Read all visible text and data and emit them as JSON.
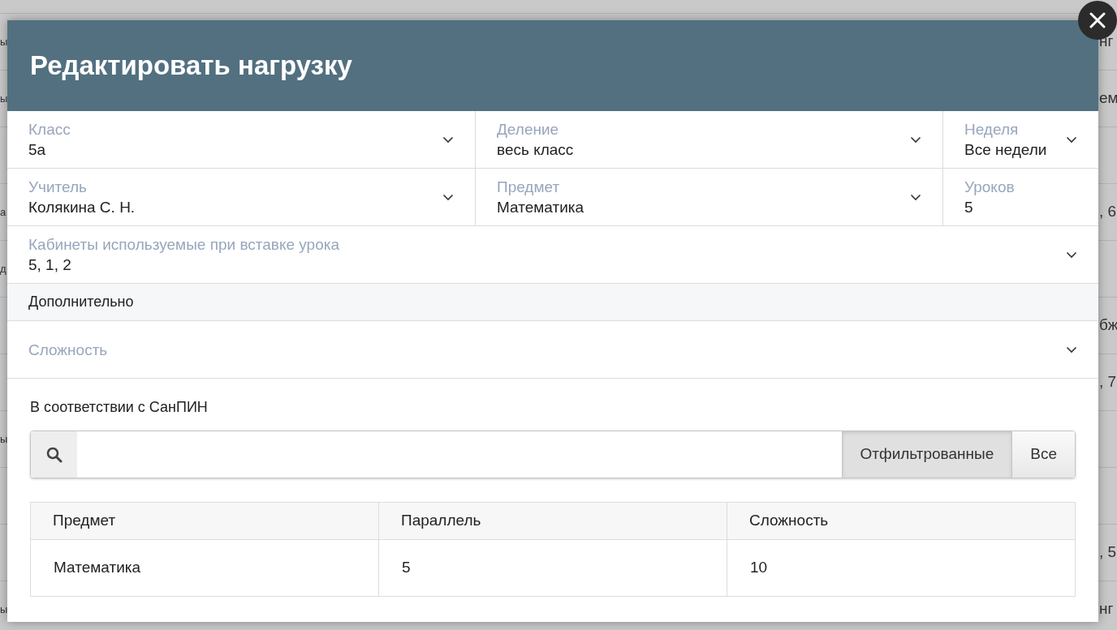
{
  "background_table": {
    "rows": [
      {},
      {
        "left": "ы",
        "right": "нг"
      },
      {
        "left": "ы",
        "right": "ем"
      },
      {},
      {
        "left": "а",
        "right": ", 6"
      },
      {
        "left": "д"
      },
      {
        "right": "бж"
      },
      {
        "right": ", 7"
      },
      {
        "left": "ы"
      },
      {},
      {
        "right": ", 5"
      },
      {
        "left": "ы",
        "right": "нг"
      }
    ]
  },
  "dialog": {
    "title": "Редактировать нагрузку",
    "field_rows": [
      [
        {
          "label": "Класс",
          "value": "5а",
          "kind": "select"
        },
        {
          "label": "Деление",
          "value": "весь класс",
          "kind": "select"
        },
        {
          "label": "Неделя",
          "value": "Все недели",
          "kind": "select"
        }
      ],
      [
        {
          "label": "Учитель",
          "value": "Колякина С. Н.",
          "kind": "select"
        },
        {
          "label": "Предмет",
          "value": "Математика",
          "kind": "select"
        },
        {
          "label": "Уроков",
          "value": "5",
          "kind": "input"
        }
      ],
      [
        {
          "label": "Кабинеты используемые при вставке урока",
          "value": "5, 1, 2",
          "kind": "select"
        }
      ]
    ],
    "section_title": "Дополнительно",
    "extra_fields": [
      {
        "label": "Сложность",
        "kind": "select"
      }
    ],
    "sanpin": {
      "title": "В соответствии с СанПИН",
      "filters": [
        {
          "label": "Отфильтрованные",
          "selected": true
        },
        {
          "label": "Все",
          "selected": false
        }
      ],
      "table": {
        "columns": [
          "Предмет",
          "Параллель",
          "Сложность"
        ],
        "rows": [
          [
            "Математика",
            "5",
            "10"
          ]
        ]
      }
    }
  }
}
